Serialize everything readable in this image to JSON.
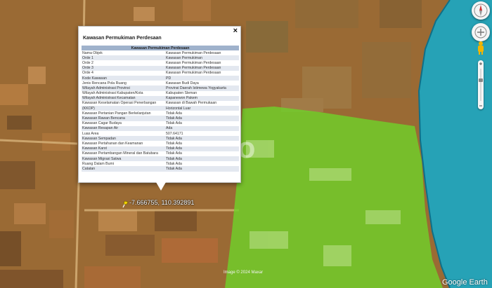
{
  "popup": {
    "title": "Kawasan Permukiman Perdesaan",
    "close_label": "×",
    "table_header": "Kawasan Permukiman Perdesaan",
    "rows": [
      {
        "key": "Nama Objek",
        "value": "Kawasan Permukiman Perdesaan"
      },
      {
        "key": "Orde 1",
        "value": "Kawasan Permukiman"
      },
      {
        "key": "Orde 2",
        "value": "Kawasan Permukiman Perdesaan"
      },
      {
        "key": "Orde 3",
        "value": "Kawasan Permukiman Perdesaan"
      },
      {
        "key": "Orde 4",
        "value": "Kawasan Permukiman Perdesaan"
      },
      {
        "key": "Kode Kawasan",
        "value": "PD"
      },
      {
        "key": "Jenis Rencana Pola Ruang",
        "value": "Kawasan Budi Daya"
      },
      {
        "key": "Wilayah Administrasi Provinsi",
        "value": "Provinsi Daerah Istimewa Yogyakarta"
      },
      {
        "key": "Wilayah Administrasi Kabupaten/Kota",
        "value": "Kabupaten Sleman"
      },
      {
        "key": "Wilayah Administrasi Kecamatan",
        "value": "Kapanewon Pakem"
      },
      {
        "key": "Kawasan Keselamatan Operasi Penerbangan",
        "value": "Kawasan di Bawah Permukaan"
      },
      {
        "key": "(KKOP)",
        "value": "Horizontal Luar"
      },
      {
        "key": "Kawasan Pertanian Pangan Berkelanjutan",
        "value": "Tidak Ada"
      },
      {
        "key": "Kawasan Rawan Bencana",
        "value": "Tidak Ada"
      },
      {
        "key": "Kawasan Cagar Budaya",
        "value": "Tidak Ada"
      },
      {
        "key": "Kawasan Resapan Air",
        "value": "Ada"
      },
      {
        "key": "Luas Area",
        "value": "507.64171"
      },
      {
        "key": "Kawasan Sempadan",
        "value": "Tidak Ada"
      },
      {
        "key": "Kawasan Pertahanan dan Keamanan",
        "value": "Tidak Ada"
      },
      {
        "key": "Kawasan Karst",
        "value": "Tidak Ada"
      },
      {
        "key": "Kawasan Pertambangan Mineral dan Batubara",
        "value": "Tidak Ada"
      },
      {
        "key": "Kawasan Migrasi Satwa",
        "value": "Tidak Ada"
      },
      {
        "key": "Ruang Dalam Bumi",
        "value": "Tidak Ada"
      },
      {
        "key": "Catatan",
        "value": "Tidak Ada"
      }
    ]
  },
  "coordinates": "-7.666755, 110.392891",
  "watermark": "99.co",
  "image_date_label": "Image © 2024 Maxar",
  "branding": "Google Earth",
  "colors": {
    "settlement_overlay": "#a8672a",
    "agriculture_overlay": "#6fd12a",
    "river_overlay": "#1aa9c4",
    "pin": "#f0d000"
  },
  "icons": {
    "compass": "compass-icon",
    "look": "look-icon",
    "pegman": "pegman-icon",
    "zoom_in": "zoom-in-icon",
    "zoom_out": "zoom-out-icon",
    "pin": "map-pin-icon"
  }
}
